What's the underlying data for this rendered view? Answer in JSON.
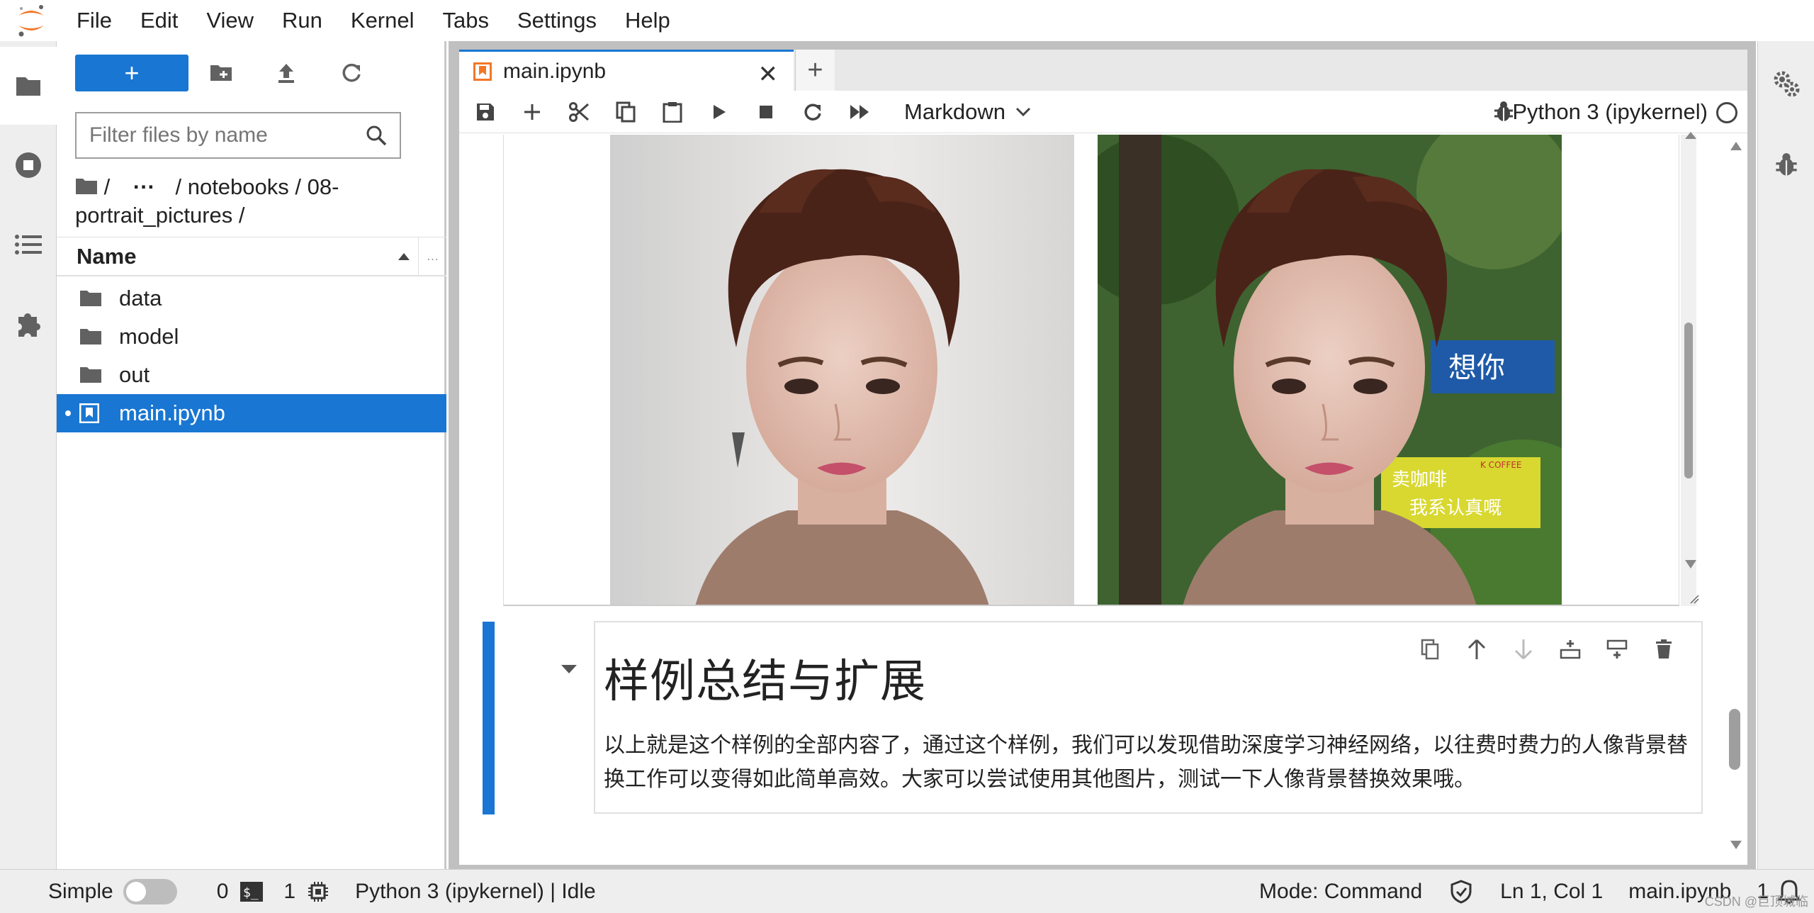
{
  "menubar": {
    "items": [
      "File",
      "Edit",
      "View",
      "Run",
      "Kernel",
      "Tabs",
      "Settings",
      "Help"
    ]
  },
  "leftbar": {
    "tabs": [
      "folder-icon",
      "running-icon",
      "table-of-contents-icon",
      "extension-icon"
    ]
  },
  "filebrowser": {
    "new_label": "+",
    "filter_placeholder": "Filter files by name",
    "breadcrumb": [
      "/",
      "···",
      "/ notebooks / 08-portrait_pictures /"
    ],
    "column_header": "Name",
    "items": [
      {
        "name": "data",
        "type": "folder"
      },
      {
        "name": "model",
        "type": "folder"
      },
      {
        "name": "out",
        "type": "folder"
      },
      {
        "name": "main.ipynb",
        "type": "notebook",
        "selected": true
      }
    ]
  },
  "tabs": {
    "active_tab": "main.ipynb",
    "add_label": "+"
  },
  "notebook_toolbar": {
    "cell_type": "Markdown",
    "kernel": "Python 3 (ipykernel)"
  },
  "markdown_cell": {
    "heading": "样例总结与扩展",
    "paragraph": "以上就是这个样例的全部内容了，通过这个样例，我们可以发现借助深度学习神经网络，以往费时费力的人像背景替换工作可以变得如此简单高效。大家可以尝试使用其他图片，测试一下人像背景替换效果哦。"
  },
  "output_images": {
    "right_sign_text": "想你",
    "right_sign2_line1": "卖咖啡",
    "right_sign2_line2": "我系认真嘅",
    "right_sign2_brand": "K COFFEE"
  },
  "statusbar": {
    "mode_label": "Simple",
    "terminals_count": "0",
    "kernels_count": "1",
    "kernel_status": "Python 3 (ipykernel) | Idle",
    "mode": "Mode: Command",
    "cursor": "Ln 1, Col 1",
    "file": "main.ipynb",
    "notifications": "1",
    "watermark": "CSDN @巨顶城临"
  },
  "colors": {
    "accent": "#1976d2",
    "logo_orange": "#f37726"
  }
}
